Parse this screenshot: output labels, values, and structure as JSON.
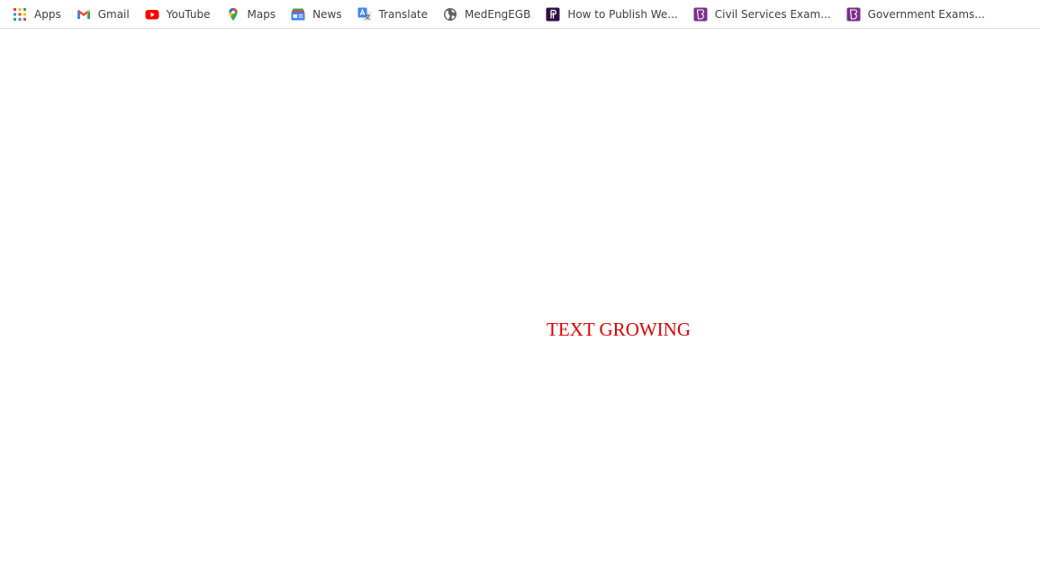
{
  "bookmarks": [
    {
      "label": "Apps",
      "icon": "apps-grid-icon"
    },
    {
      "label": "Gmail",
      "icon": "gmail-icon"
    },
    {
      "label": "YouTube",
      "icon": "youtube-icon"
    },
    {
      "label": "Maps",
      "icon": "maps-pin-icon"
    },
    {
      "label": "News",
      "icon": "news-icon"
    },
    {
      "label": "Translate",
      "icon": "translate-icon"
    },
    {
      "label": "MedEngEGB",
      "icon": "globe-icon"
    },
    {
      "label": "How to Publish We...",
      "icon": "p-logo-icon"
    },
    {
      "label": "Civil Services Exam...",
      "icon": "b-logo-icon"
    },
    {
      "label": "Government Exams...",
      "icon": "b-logo-icon"
    }
  ],
  "page": {
    "text": "TEXT GROWING",
    "text_color": "#e00000"
  }
}
